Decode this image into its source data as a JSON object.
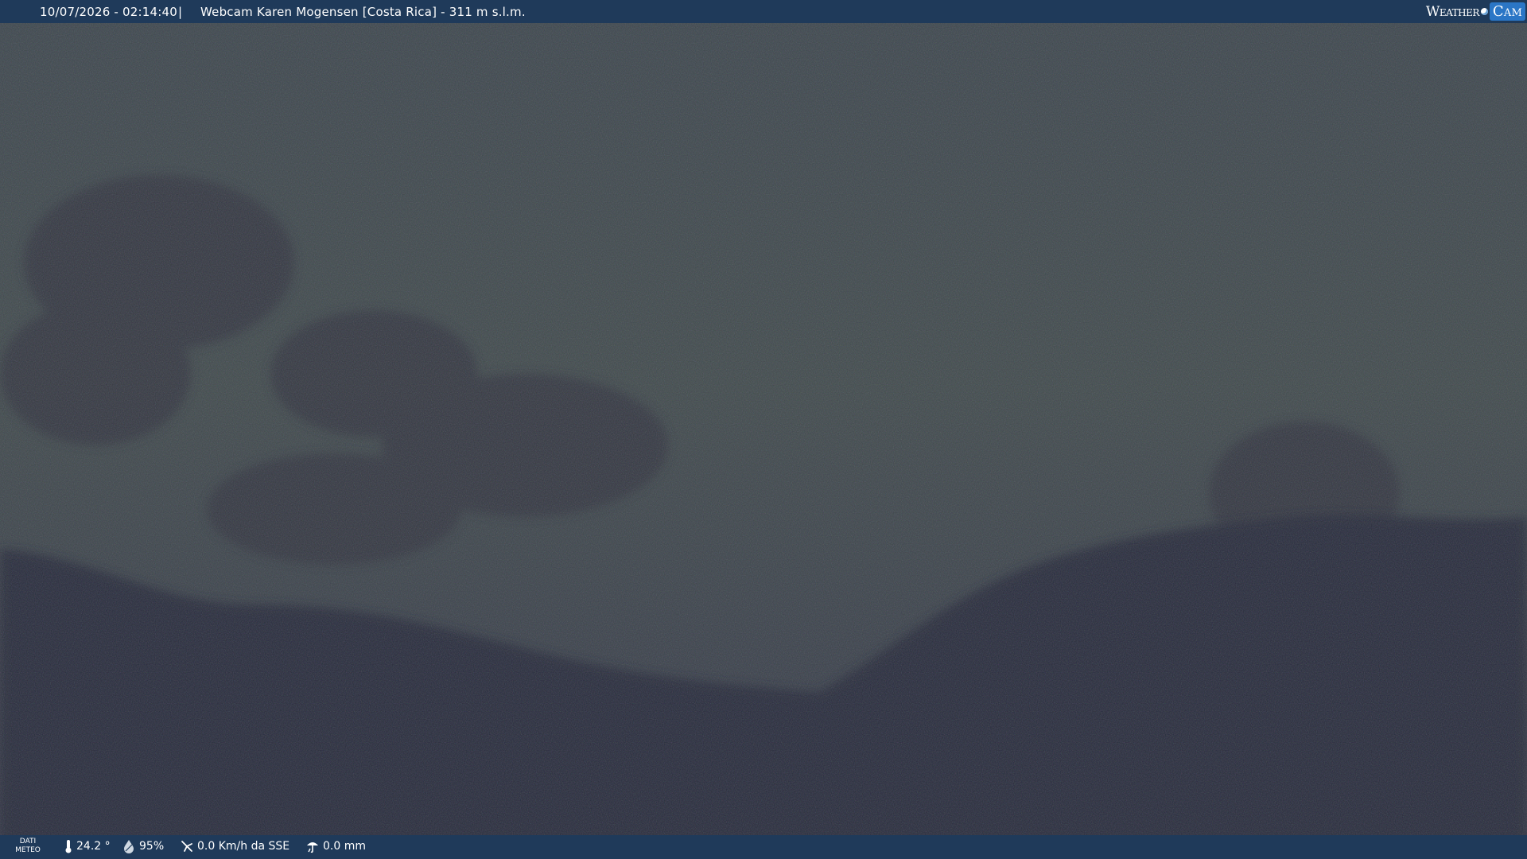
{
  "overlay_top": {
    "timestamp": "10/07/2026 - 02:14:40",
    "separator": "|",
    "camera_title": "Webcam Karen Mogensen [Costa Rica]  - 311 m s.l.m.",
    "logo_weather": "Weather",
    "logo_cam": "Cam"
  },
  "overlay_bottom": {
    "dati_line1": "DATI",
    "dati_line2": "METEO",
    "temperature": "24.2 °",
    "humidity": "95%",
    "wind": "0.0 Km/h da SSE",
    "rain": "0.0 mm",
    "icons": [
      "thermometer-icon",
      "humidity-drop-icon",
      "wind-icon",
      "rain-icon"
    ]
  },
  "colors": {
    "bar_background": "#1f3a5a",
    "logo_cam_background": "#2b76c6",
    "sky": "#3e4751",
    "forest_dark": "#252b3b"
  }
}
